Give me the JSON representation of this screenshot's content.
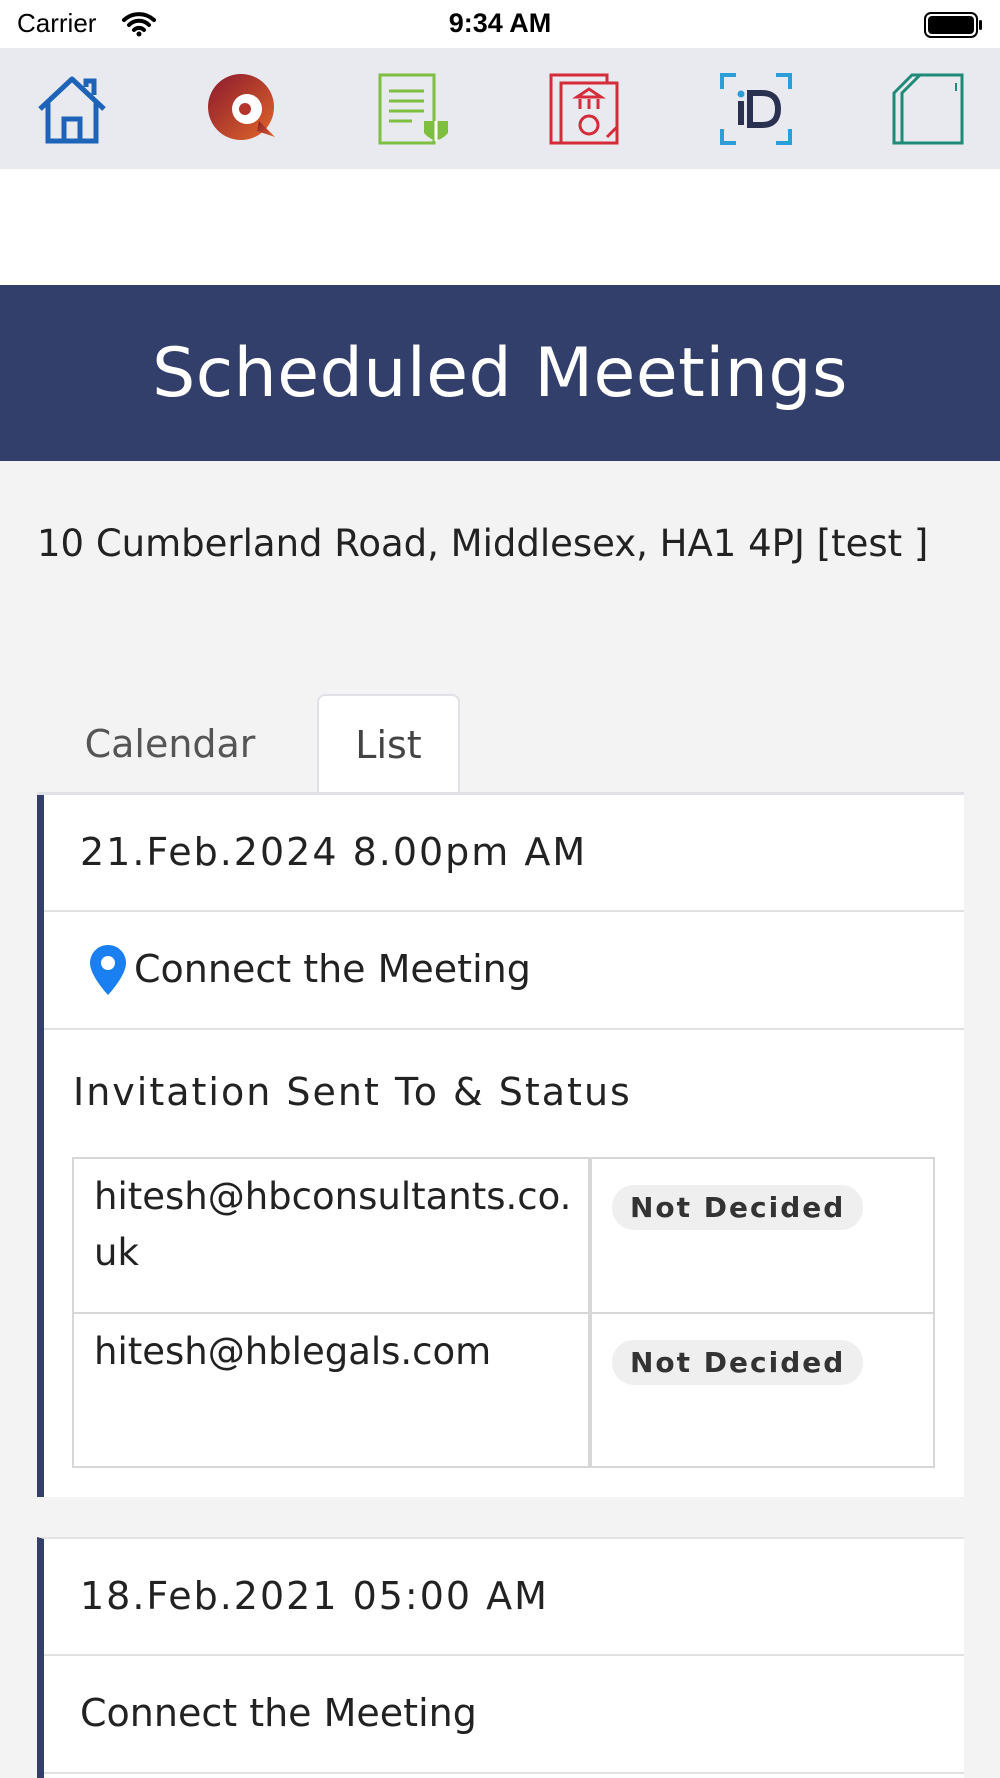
{
  "status_bar": {
    "carrier": "Carrier",
    "time": "9:34 AM"
  },
  "toolbar": {
    "icons": [
      "home-icon",
      "search-chat-icon",
      "document-shield-icon",
      "bank-document-icon",
      "id-scan-icon",
      "folder-icon"
    ],
    "colors": {
      "home": "#1d63b8",
      "search": "#a3201f",
      "document": "#7fbf3f",
      "bank": "#d42c3a",
      "id": "#2b9ed8",
      "folder": "#1f8a78"
    }
  },
  "header": {
    "title": "Scheduled Meetings"
  },
  "address": "10 Cumberland Road, Middlesex, HA1 4PJ [test ]",
  "tabs": [
    {
      "label": "Calendar",
      "active": false
    },
    {
      "label": "List",
      "active": true
    }
  ],
  "meetings": [
    {
      "datetime": "21.Feb.2024 8.00pm AM",
      "connect_label": "Connect the Meeting",
      "invitation_title": "Invitation Sent To & Status",
      "invitees": [
        {
          "email": "hitesh@hbconsultants.co.uk",
          "status": "Not Decided"
        },
        {
          "email": "hitesh@hblegals.com",
          "status": "Not Decided"
        }
      ]
    },
    {
      "datetime": "18.Feb.2021 05:00 AM",
      "connect_label": "Connect the Meeting"
    }
  ],
  "colors": {
    "header_bg": "#333f6b",
    "accent": "#333f6b",
    "pin": "#1a7ff0"
  }
}
